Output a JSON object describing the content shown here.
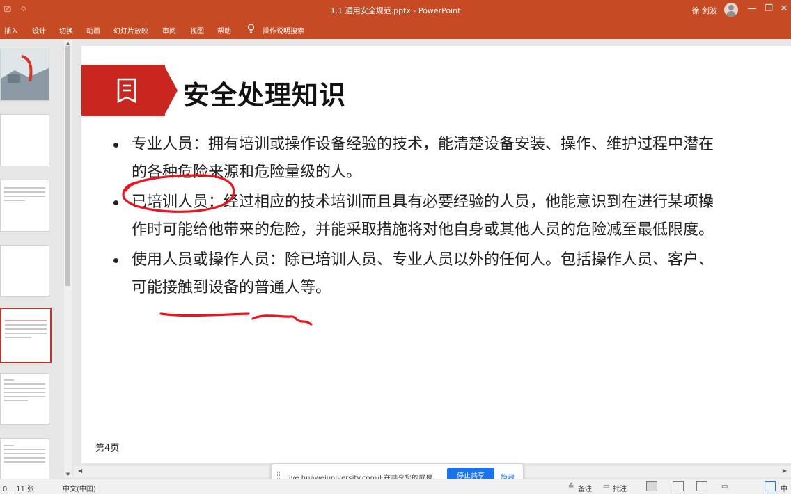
{
  "window": {
    "title": "1.1 通用安全规范.pptx - PowerPoint",
    "user_name": "徐 剑波",
    "controls": {
      "minimize": "—",
      "restore": "❐",
      "close": "✕"
    }
  },
  "ribbon": {
    "tabs": [
      "插入",
      "设计",
      "切换",
      "动画",
      "幻灯片放映",
      "审阅",
      "视图",
      "帮助"
    ],
    "tell_me": "操作说明搜索"
  },
  "slide": {
    "title": "安全处理知识",
    "bullets": [
      {
        "line1": "专业人员：拥有培训或操作设备经验的技术，能清楚设备安装、操作、维护过程中潜在",
        "line2": "的各种危险来源和危险量级的人。"
      },
      {
        "line1": "已培训人员：经过相应的技术培训而且具有必要经验的人员，他能意识到在进行某项操",
        "line2": "作时可能给他带来的危险，并能采取措施将对他自身或其他人员的危险减至最低限度。"
      },
      {
        "line1": "使用人员或操作人员：除已培训人员、专业人员以外的任何人。包括操作人员、客户、",
        "line2": "可能接触到设备的普通人等。"
      }
    ],
    "page_number": "第4页",
    "accent_color": "#c8261f"
  },
  "share_banner": {
    "message": "live.huaweiuniversity.com正在共享您的屏幕。",
    "stop_button": "停止共享",
    "hide_link": "隐藏"
  },
  "statusbar": {
    "slide_info": "0... 11 张",
    "language": "中文(中国)",
    "notes": "备注",
    "comments": "批注",
    "zoom_label": "中"
  },
  "annotation_color": "#e8141e"
}
